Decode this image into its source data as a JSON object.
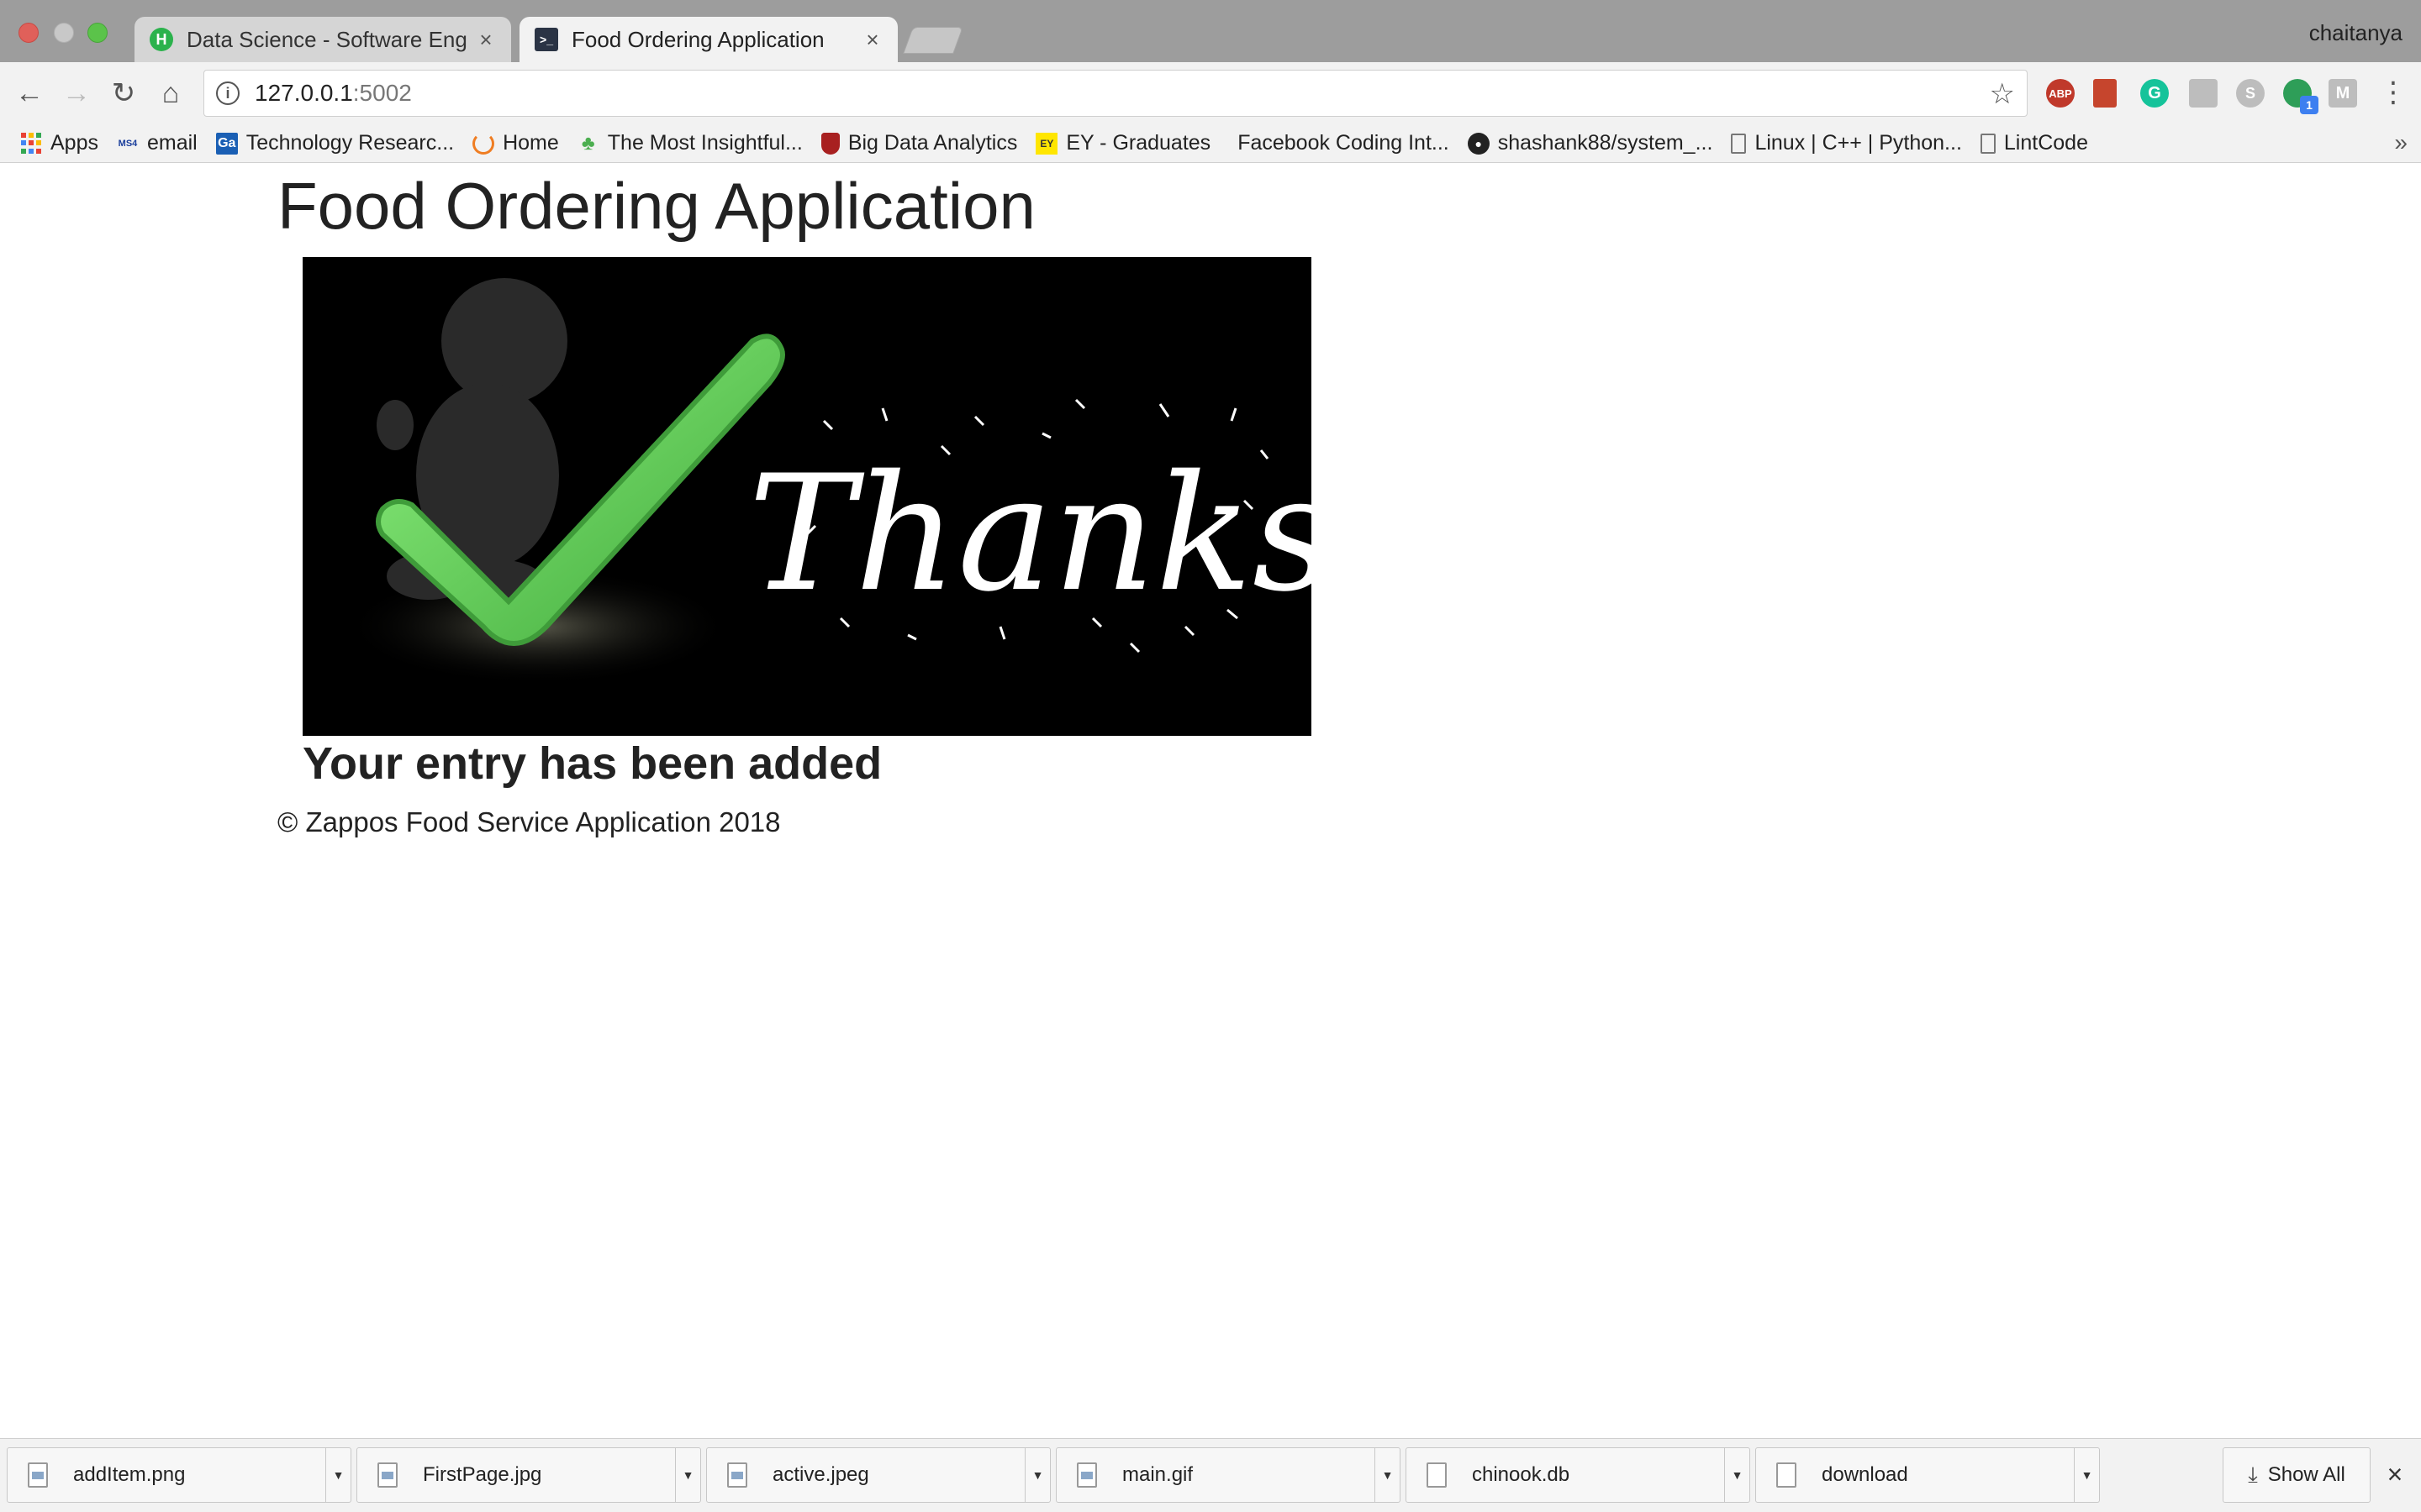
{
  "browser": {
    "profile_name": "chaitanya",
    "tabs": [
      {
        "title": "Data Science - Software Engin",
        "favicon": "H",
        "favicon_icon": "hackerrank-icon"
      },
      {
        "title": "Food Ordering Application",
        "favicon": ">_",
        "favicon_icon": "terminal-icon"
      }
    ],
    "url": {
      "host": "127.0.0.1",
      "port": ":5002"
    },
    "bookmarks": [
      {
        "label": "Apps",
        "icon": "apps-grid-icon"
      },
      {
        "label": "email",
        "icon": "ms4-icon",
        "icon_text": "MS4"
      },
      {
        "label": "Technology Researc...",
        "icon": "gartner-icon",
        "icon_text": "Ga"
      },
      {
        "label": "Home",
        "icon": "ring-icon"
      },
      {
        "label": "The Most Insightful...",
        "icon": "tree-icon"
      },
      {
        "label": "Big Data Analytics",
        "icon": "shield-icon"
      },
      {
        "label": "EY - Graduates",
        "icon": "ey-icon",
        "icon_text": "EY"
      },
      {
        "label": "Facebook Coding Int...",
        "icon": ""
      },
      {
        "label": "shashank88/system_...",
        "icon": "github-icon"
      },
      {
        "label": "Linux | C++ | Python...",
        "icon": "page-icon"
      },
      {
        "label": "LintCode",
        "icon": "page-icon"
      }
    ],
    "extensions": {
      "abp": "ABP",
      "grammarly": "G",
      "skype": "S",
      "mercury": "M",
      "badge_count": "1"
    },
    "colors": {
      "tab_strip": "#9d9d9d",
      "toolbar": "#f2f2f2",
      "close_light": "#e0605a",
      "max_light": "#5bc34a"
    }
  },
  "page": {
    "title": "Food Ordering Application",
    "image_text": "Thanks!",
    "confirmation": "Your entry has been added",
    "footer": "© Zappos Food Service Application 2018",
    "colors": {
      "checkmark": "#5ed35a",
      "image_background": "#000000"
    }
  },
  "downloads": {
    "items": [
      {
        "name": "addItem.png"
      },
      {
        "name": "FirstPage.jpg"
      },
      {
        "name": "active.jpeg"
      },
      {
        "name": "main.gif"
      },
      {
        "name": "chinook.db"
      },
      {
        "name": "download"
      }
    ],
    "show_all_label": "Show All"
  }
}
